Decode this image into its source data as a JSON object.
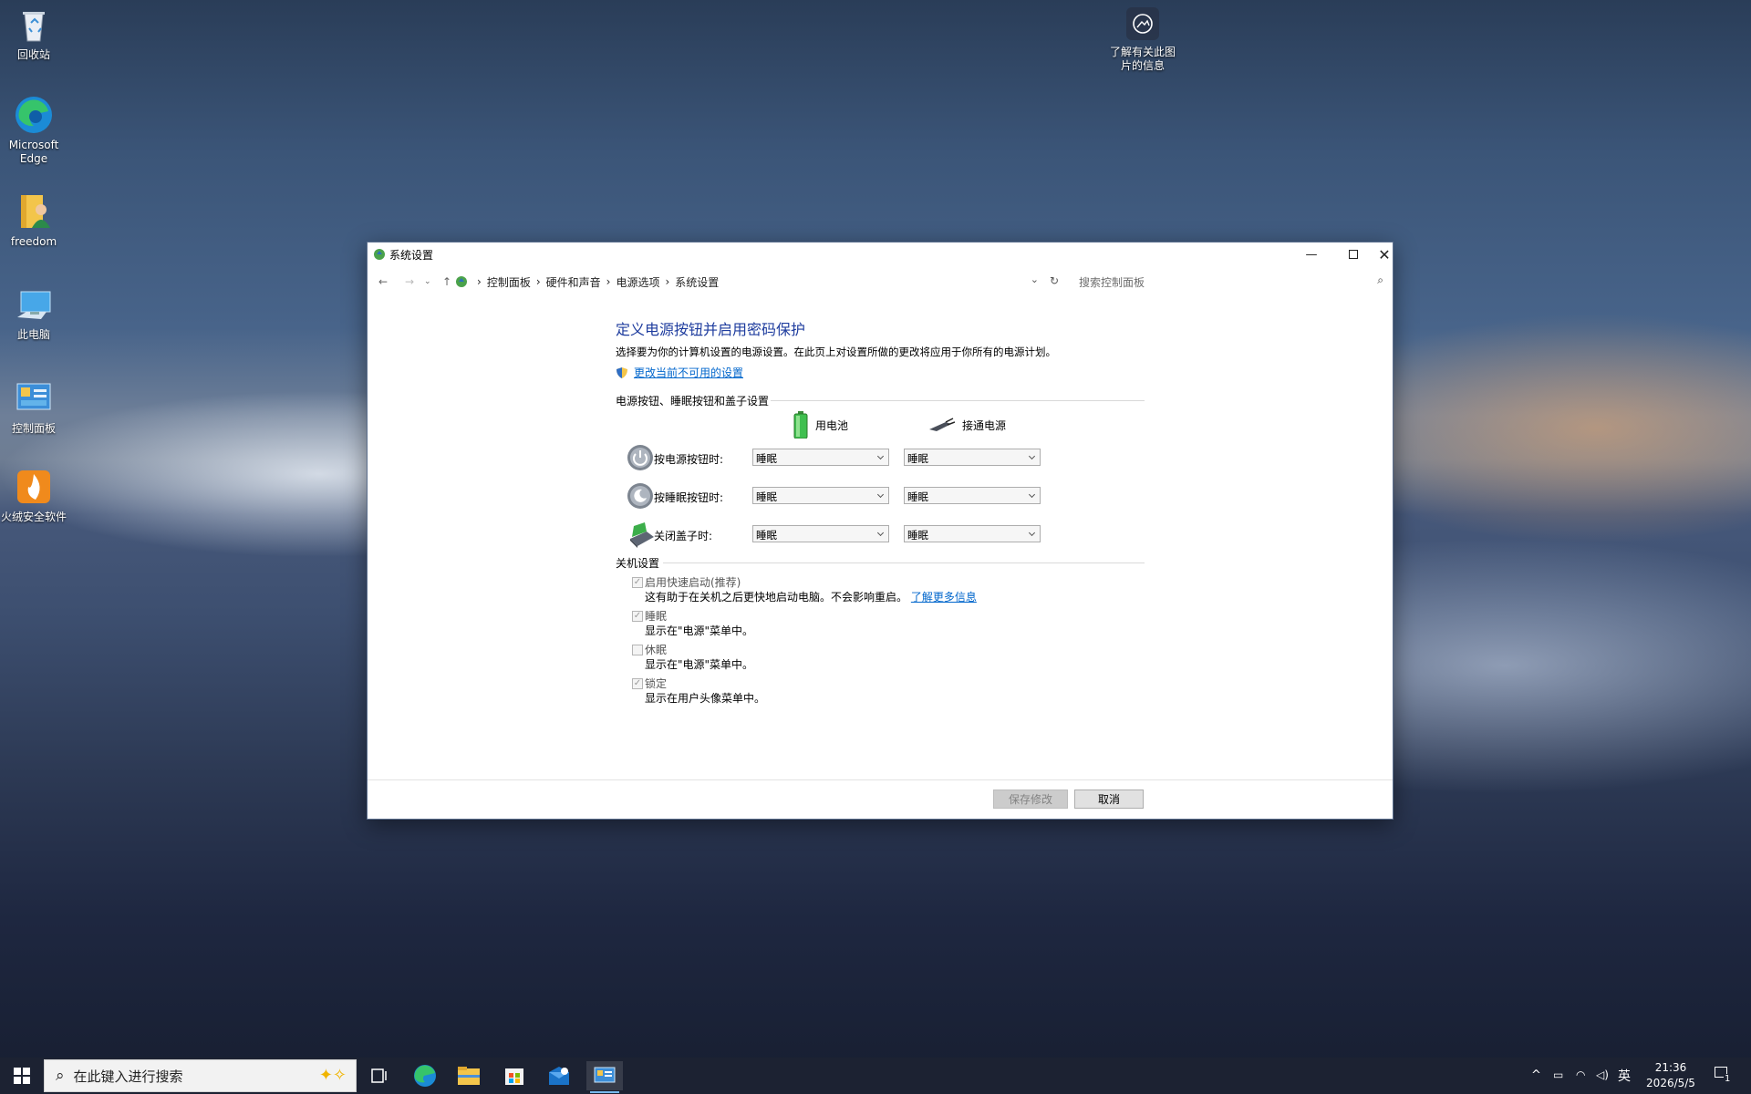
{
  "desktop": {
    "icons": [
      {
        "label": "回收站",
        "icon": "recycle-bin-icon"
      },
      {
        "label": "Microsoft Edge",
        "icon": "edge-icon"
      },
      {
        "label": "freedom",
        "icon": "user-folder-icon"
      },
      {
        "label": "此电脑",
        "icon": "this-pc-icon"
      },
      {
        "label": "控制面板",
        "icon": "control-panel-icon"
      },
      {
        "label": "火绒安全软件",
        "icon": "huorong-icon"
      }
    ],
    "spotlight_label": "了解有关此图片的信息"
  },
  "window": {
    "title": "系统设置",
    "breadcrumb": [
      "控制面板",
      "硬件和声音",
      "电源选项",
      "系统设置"
    ],
    "search_placeholder": "搜索控制面板",
    "heading": "定义电源按钮并启用密码保护",
    "description": "选择要为你的计算机设置的电源设置。在此页上对设置所做的更改将应用于你所有的电源计划。",
    "change_link": "更改当前不可用的设置",
    "power_section": "电源按钮、睡眠按钮和盖子设置",
    "col_battery": "用电池",
    "col_plugged": "接通电源",
    "rows": [
      {
        "label": "按电源按钮时:",
        "battery": "睡眠",
        "plugged": "睡眠"
      },
      {
        "label": "按睡眠按钮时:",
        "battery": "睡眠",
        "plugged": "睡眠"
      },
      {
        "label": "关闭盖子时:",
        "battery": "睡眠",
        "plugged": "睡眠"
      }
    ],
    "shutdown_section": "关机设置",
    "options": [
      {
        "title": "启用快速启动(推荐)",
        "desc": "这有助于在关机之后更快地启动电脑。不会影响重启。",
        "link": "了解更多信息",
        "checked": true
      },
      {
        "title": "睡眠",
        "desc": "显示在\"电源\"菜单中。",
        "checked": true
      },
      {
        "title": "休眠",
        "desc": "显示在\"电源\"菜单中。",
        "checked": false
      },
      {
        "title": "锁定",
        "desc": "显示在用户头像菜单中。",
        "checked": true
      }
    ],
    "save_label": "保存修改",
    "cancel_label": "取消"
  },
  "taskbar": {
    "search_placeholder": "在此键入进行搜索",
    "ime": "英",
    "time": "21:36",
    "date": "2026/5/5",
    "notification_count": "1"
  },
  "colors": {
    "heading": "#1e3c9e",
    "link": "#0066cc",
    "taskbar": "#1c2232",
    "accent": "#0078d4"
  }
}
